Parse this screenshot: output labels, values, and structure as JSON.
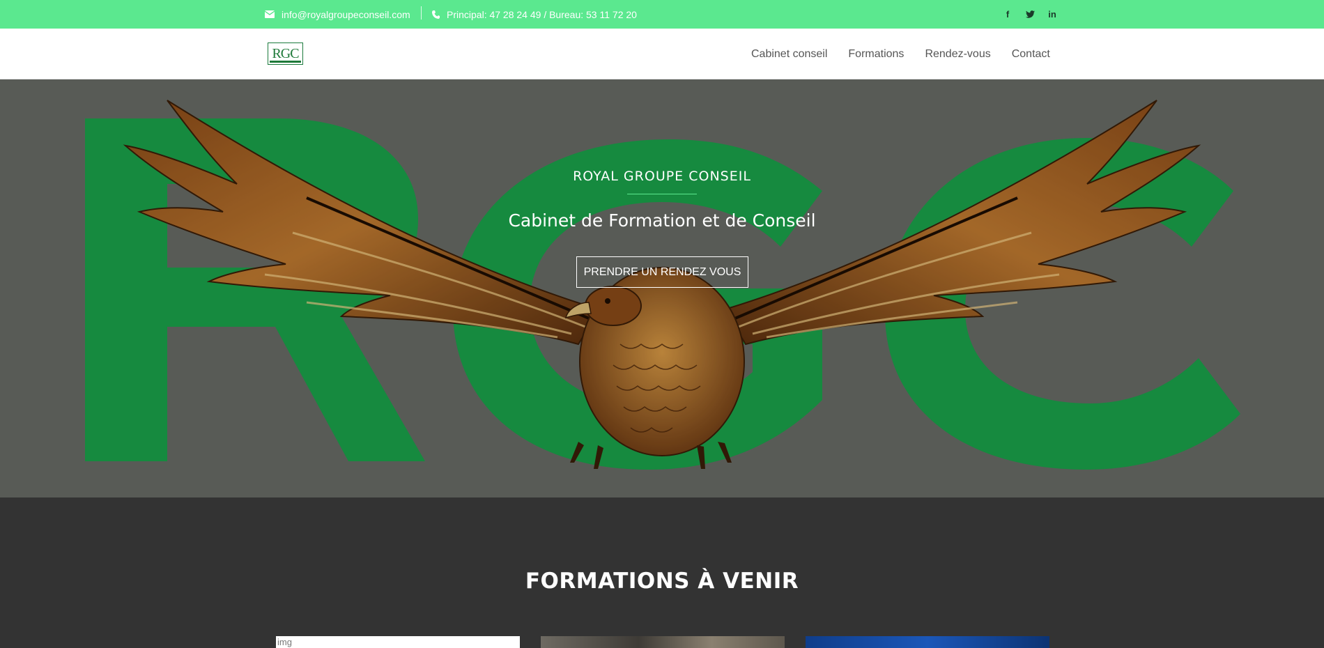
{
  "topbar": {
    "email": "info@royalgroupeconseil.com",
    "phone": "Principal: 47 28 24 49 / Bureau: 53 11 72 20",
    "social": {
      "facebook": "f",
      "twitter": "twitter-icon",
      "linkedin": "in"
    },
    "bg_color": "#5be88f"
  },
  "navbar": {
    "logo_text": "RGC",
    "items": [
      {
        "label": "Cabinet conseil"
      },
      {
        "label": "Formations"
      },
      {
        "label": "Rendez-vous"
      },
      {
        "label": "Contact"
      }
    ]
  },
  "hero": {
    "subtitle": "ROYAL GROUPE CONSEIL",
    "title": "Cabinet de Formation et de Conseil",
    "button_label": "PRENDRE UN RENDEZ VOUS",
    "accent_color": "#1aa34a"
  },
  "section": {
    "title": "FORMATIONS À VENIR",
    "cards": [
      {
        "image_alt": "img"
      },
      {
        "image_alt": ""
      },
      {
        "image_alt": ""
      }
    ]
  }
}
